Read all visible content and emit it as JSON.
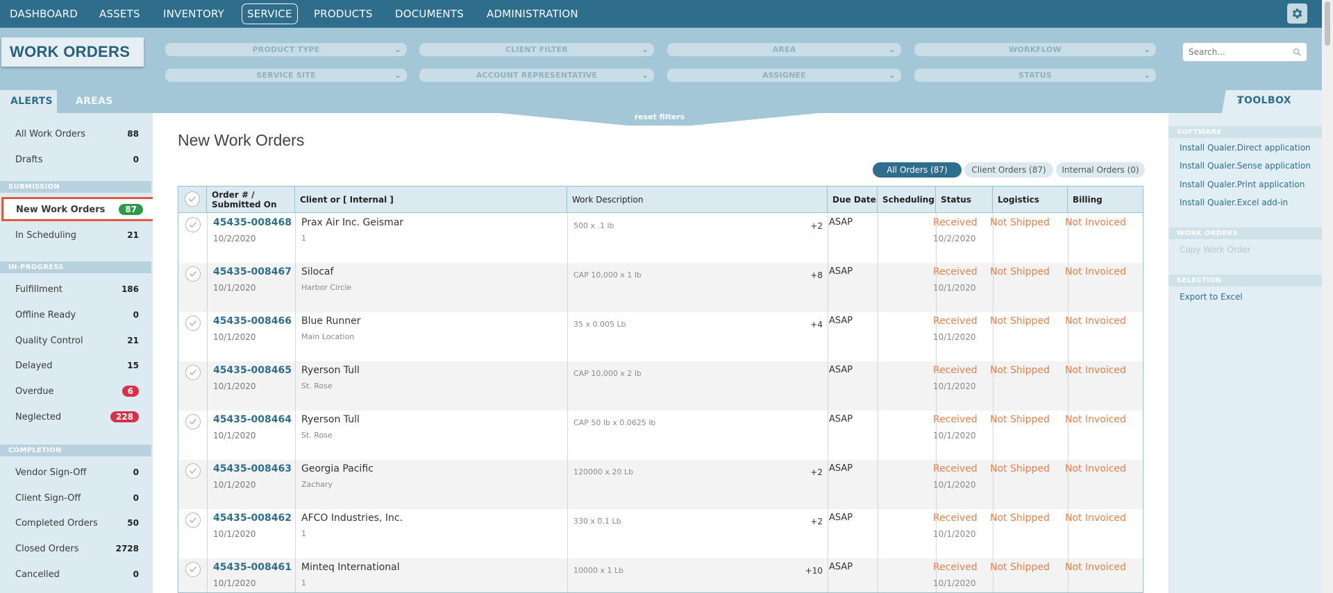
{
  "nav": {
    "items": [
      "DASHBOARD",
      "ASSETS",
      "INVENTORY",
      "SERVICE",
      "PRODUCTS",
      "DOCUMENTS",
      "ADMINISTRATION"
    ],
    "active": "SERVICE"
  },
  "header": {
    "title": "WORK ORDERS",
    "filters": [
      "PRODUCT TYPE",
      "CLIENT FILTER",
      "AREA",
      "WORKFLOW",
      "SERVICE SITE",
      "ACCOUNT REPRESENTATIVE",
      "ASSIGNEE",
      "STATUS"
    ],
    "search_placeholder": "Search...",
    "reset_label": "reset filters",
    "tabs": [
      "ALERTS",
      "AREAS"
    ],
    "toolbox_label": "TOOLBOX"
  },
  "sidebar": {
    "top": [
      {
        "label": "All Work Orders",
        "count": "88"
      },
      {
        "label": "Drafts",
        "count": "0"
      }
    ],
    "sections": [
      {
        "title": "SUBMISSION",
        "items": [
          {
            "label": "New Work Orders",
            "count": "87"
          },
          {
            "label": "In Scheduling",
            "count": "21"
          }
        ]
      },
      {
        "title": "IN-PROGRESS",
        "items": [
          {
            "label": "Fulfillment",
            "count": "186"
          },
          {
            "label": "Offline Ready",
            "count": "0"
          },
          {
            "label": "Quality Control",
            "count": "21"
          },
          {
            "label": "Delayed",
            "count": "15"
          },
          {
            "label": "Overdue",
            "count": "6"
          },
          {
            "label": "Neglected",
            "count": "228"
          }
        ]
      },
      {
        "title": "COMPLETION",
        "items": [
          {
            "label": "Vendor Sign-Off",
            "count": "0"
          },
          {
            "label": "Client Sign-Off",
            "count": "0"
          },
          {
            "label": "Completed Orders",
            "count": "50"
          },
          {
            "label": "Closed Orders",
            "count": "2728"
          },
          {
            "label": "Cancelled",
            "count": "0"
          }
        ]
      }
    ]
  },
  "main": {
    "title": "New Work Orders",
    "pills": [
      "All Orders (87)",
      "Client Orders (87)",
      "Internal Orders (0)"
    ],
    "columns": {
      "order": "Order # /",
      "submitted": "Submitted On",
      "client": "Client or [ Internal ]",
      "description": "Work Description",
      "due": "Due Date",
      "scheduling": "Scheduling",
      "status": "Status",
      "logistics": "Logistics",
      "billing": "Billing"
    },
    "rows": [
      {
        "order": "45435-008468",
        "date": "10/2/2020",
        "client": "Prax Air Inc. Geismar",
        "client_sub": "1",
        "desc": "500 x .1 lb",
        "plus": "+2",
        "due": "ASAP",
        "status": "Received",
        "status_date": "10/2/2020",
        "logistics": "Not Shipped",
        "billing": "Not Invoiced"
      },
      {
        "order": "45435-008467",
        "date": "10/1/2020",
        "client": "Silocaf",
        "client_sub": "Harbor Circle",
        "desc": "CAP 10,000 x 1 lb",
        "plus": "+8",
        "due": "ASAP",
        "status": "Received",
        "status_date": "10/1/2020",
        "logistics": "Not Shipped",
        "billing": "Not Invoiced"
      },
      {
        "order": "45435-008466",
        "date": "10/1/2020",
        "client": "Blue Runner",
        "client_sub": "Main Location",
        "desc": "35 x 0.005 Lb",
        "plus": "+4",
        "due": "ASAP",
        "status": "Received",
        "status_date": "10/1/2020",
        "logistics": "Not Shipped",
        "billing": "Not Invoiced"
      },
      {
        "order": "45435-008465",
        "date": "10/1/2020",
        "client": "Ryerson Tull",
        "client_sub": "St. Rose",
        "desc": "CAP 10,000 x 2 lb",
        "plus": "",
        "due": "ASAP",
        "status": "Received",
        "status_date": "10/1/2020",
        "logistics": "Not Shipped",
        "billing": "Not Invoiced"
      },
      {
        "order": "45435-008464",
        "date": "10/1/2020",
        "client": "Ryerson Tull",
        "client_sub": "St. Rose",
        "desc": "CAP 50 lb x 0.0625 lb",
        "plus": "",
        "due": "ASAP",
        "status": "Received",
        "status_date": "10/1/2020",
        "logistics": "Not Shipped",
        "billing": "Not Invoiced"
      },
      {
        "order": "45435-008463",
        "date": "10/1/2020",
        "client": "Georgia Pacific",
        "client_sub": "Zachary",
        "desc": "120000 x 20 Lb",
        "plus": "+2",
        "due": "ASAP",
        "status": "Received",
        "status_date": "10/1/2020",
        "logistics": "Not Shipped",
        "billing": "Not Invoiced"
      },
      {
        "order": "45435-008462",
        "date": "10/1/2020",
        "client": "AFCO Industries, Inc.",
        "client_sub": "1",
        "desc": "330 x 0.1 Lb",
        "plus": "+2",
        "due": "ASAP",
        "status": "Received",
        "status_date": "10/1/2020",
        "logistics": "Not Shipped",
        "billing": "Not Invoiced"
      },
      {
        "order": "45435-008461",
        "date": "10/1/2020",
        "client": "Minteq International",
        "client_sub": "1",
        "desc": "10000 x 1 Lb",
        "plus": "+10",
        "due": "ASAP",
        "status": "Received",
        "status_date": "10/1/2020",
        "logistics": "Not Shipped",
        "billing": "Not Invoiced"
      }
    ]
  },
  "toolbox": {
    "sections": [
      {
        "title": "SOFTWARE",
        "links": [
          "Install Qualer.Direct application",
          "Install Qualer.Sense application",
          "Install Qualer.Print application",
          "Install Qualer.Excel add-in"
        ]
      },
      {
        "title": "WORK ORDERS",
        "links": [
          "Copy Work Order"
        ]
      },
      {
        "title": "SELECTION",
        "links": [
          "Export to Excel"
        ]
      }
    ]
  },
  "colors": {
    "nav_bg": "#2e6e8c",
    "accent": "#2e6e8c",
    "status_orange": "#e8814a",
    "badge_red": "#d9304a",
    "badge_green": "#2c9a4a",
    "selection_outline": "#d9533a"
  }
}
